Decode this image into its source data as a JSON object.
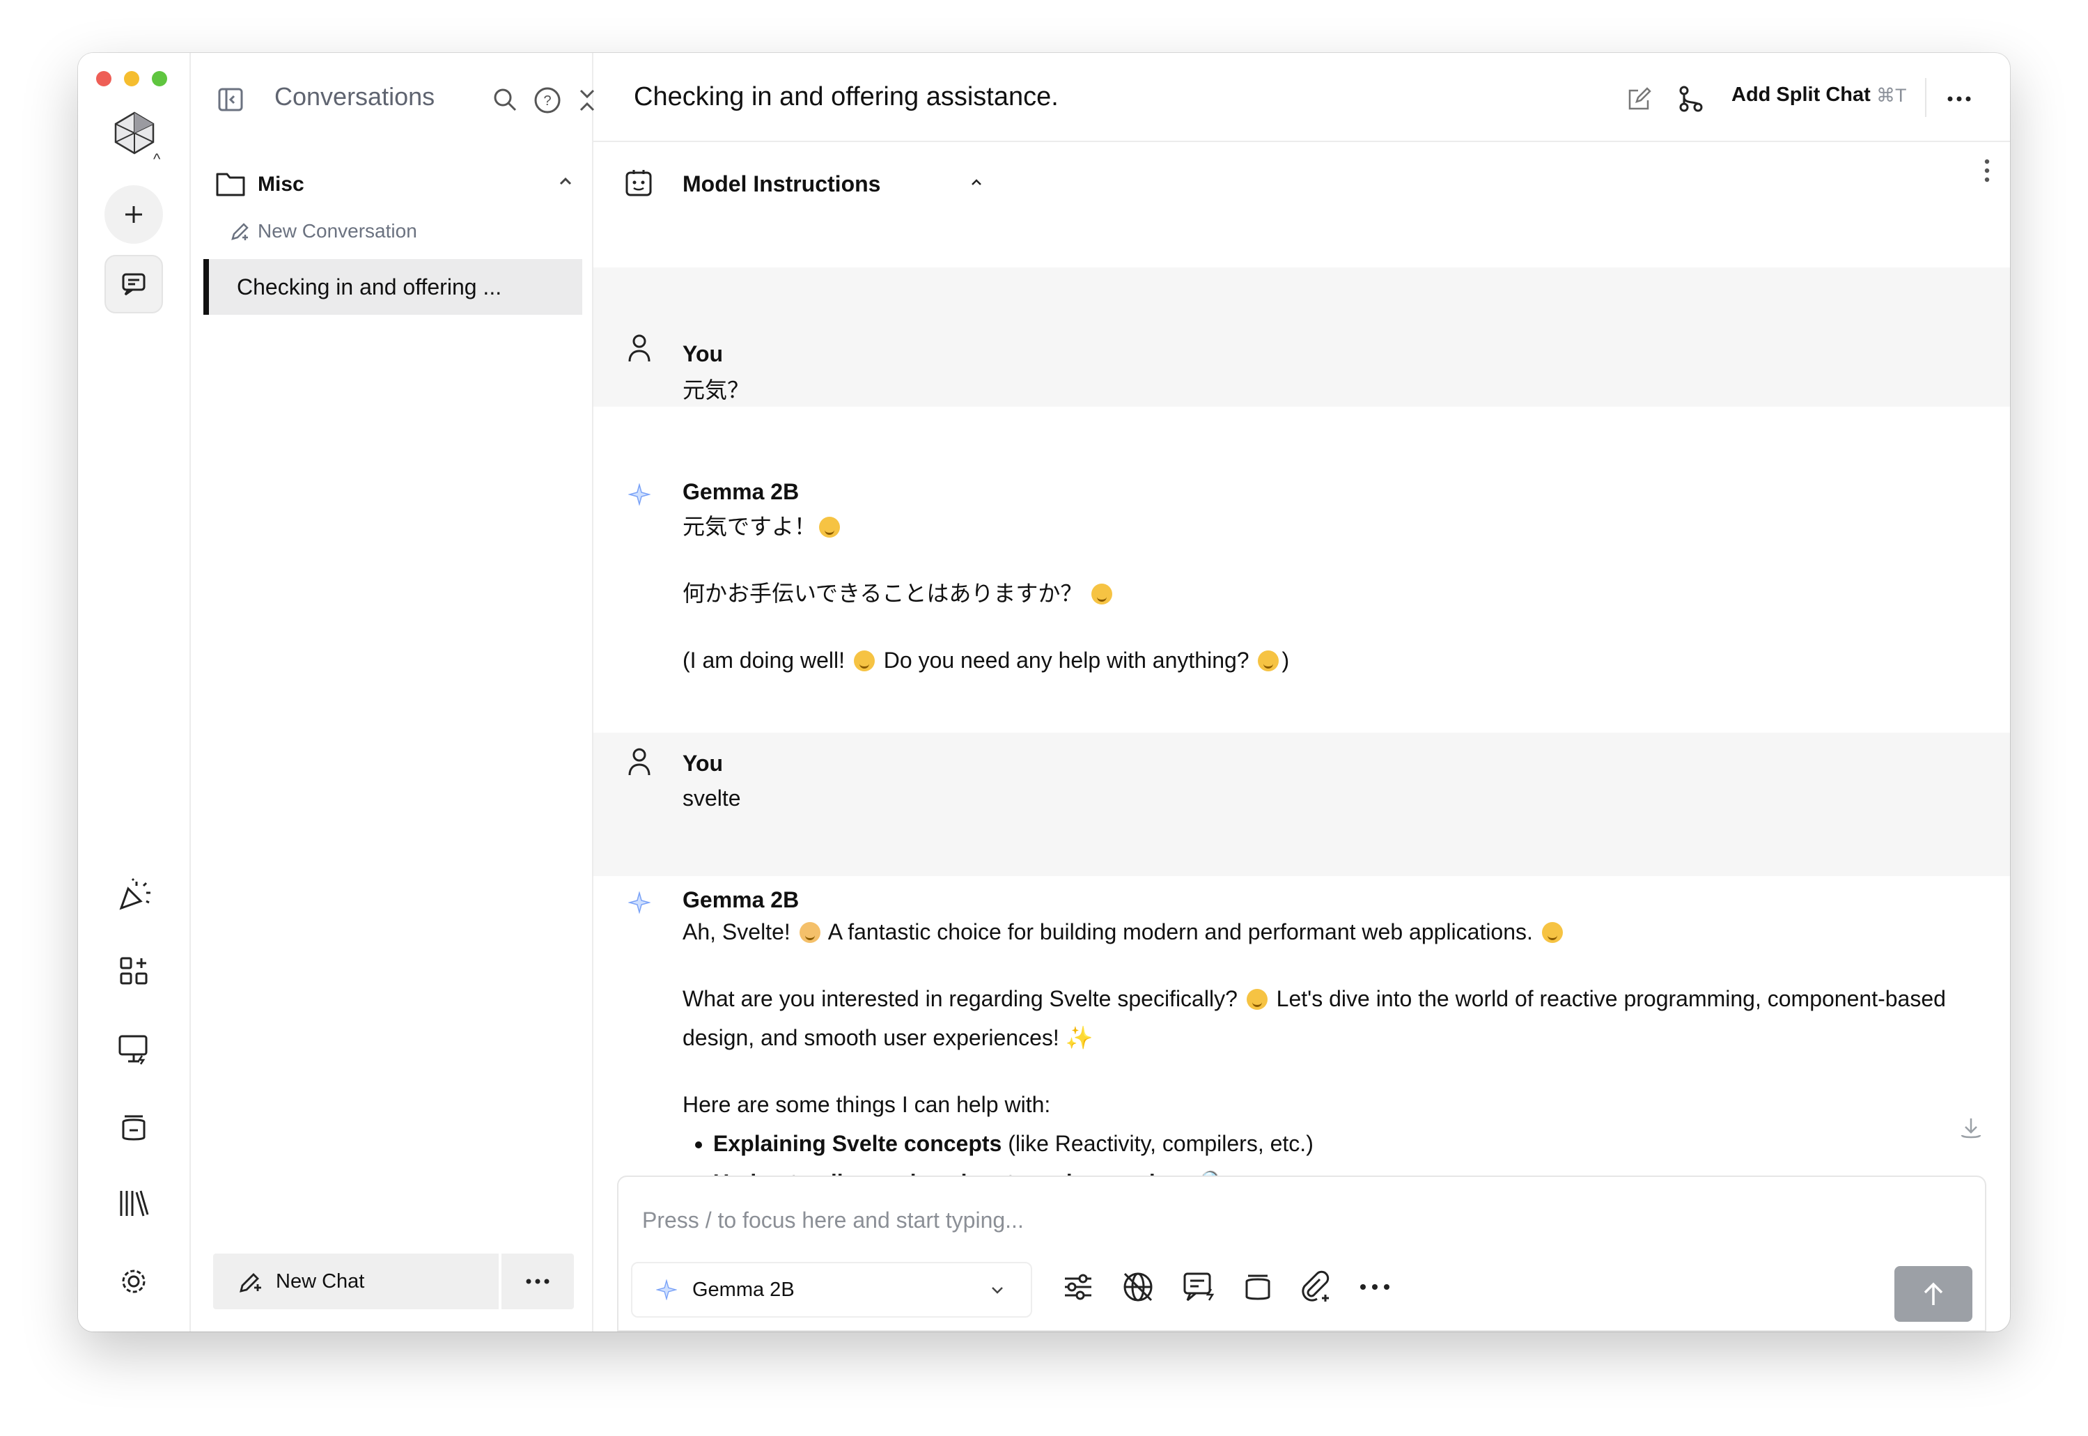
{
  "sidebar": {
    "title": "Conversations",
    "folder": "Misc",
    "new_conversation": "New Conversation",
    "items": [
      "Checking in and offering ..."
    ],
    "new_chat": "New Chat"
  },
  "header": {
    "title": "Checking in and offering assistance.",
    "split_label": "Add Split Chat",
    "split_shortcut": "⌘T"
  },
  "instructions": {
    "label": "Model Instructions"
  },
  "messages": [
    {
      "role": "user",
      "sender": "You",
      "text": "元気？"
    },
    {
      "role": "assistant",
      "sender": "Gemma 2B",
      "lines": [
        "元気ですよ！",
        "何かお手伝いできることはありますか？",
        "(I am doing well!",
        "Do you need any help with anything?",
        ")"
      ]
    },
    {
      "role": "user",
      "sender": "You",
      "text": "svelte"
    },
    {
      "role": "assistant",
      "sender": "Gemma 2B",
      "p1a": "Ah, Svelte!",
      "p1b": "A fantastic choice for building modern and performant web applications.",
      "p2a": "What are you interested in regarding Svelte specifically?",
      "p2b": "Let's dive into the world of reactive programming, component-based design, and smooth user experiences!",
      "p3": "Here are some things I can help with:",
      "b1_bold": "Explaining Svelte concepts",
      "b1_rest": " (like Reactivity, compilers, etc.)",
      "b2_bold": "Understanding code snippets and examples."
    }
  ],
  "composer": {
    "placeholder": "Press / to focus here and start typing...",
    "model": "Gemma 2B"
  },
  "colors": {
    "accent": "#111111",
    "selected_bg": "#ebebec",
    "user_msg_bg": "#f6f6f6",
    "send_bg": "#9ca0a6"
  }
}
